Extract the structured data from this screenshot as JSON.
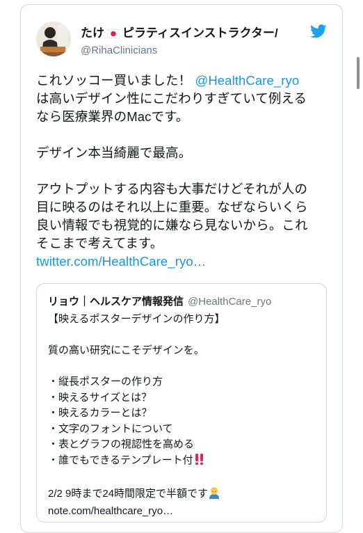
{
  "tweet": {
    "display_name": "たけ",
    "display_name_suffix": "ピラティスインストラクター/",
    "handle": "@RihaClinicians",
    "line1_prefix": "これソッコー買いました！",
    "mention": "@HealthCare_ryo",
    "line2": "は高いデザイン性にこだわりすぎていて例える",
    "line3": "なら医療業界のMacです。",
    "para2": "デザイン本当綺麗で最高。",
    "para3_line1": "アウトプットする内容も大事だけどそれが人の",
    "para3_line2": "目に映るのはそれ以上に重要。なぜならいくら",
    "para3_line3": "良い情報でも視覚的に嫌なら見ないから。これ",
    "para3_line4": "そこまで考えてます。",
    "link": "twitter.com/HealthCare_ryo…"
  },
  "quote": {
    "name": "リョウ｜ヘルスケア情報発信",
    "handle": "@HealthCare_ryo",
    "title": "【映えるポスターデザインの作り方】",
    "intro": "質の高い研究にこそデザインを。",
    "items": [
      "・縦長ポスターの作り方",
      "・映えるサイズとは？",
      "・映えるカラーとは？",
      "・文字のフォントについて",
      "・表とグラフの視認性を高める",
      "・誰でもできるテンプレート付"
    ],
    "footer": "2/2  9時まで24時間限定で半額です",
    "link": "note.com/healthcare_ryo…"
  },
  "icons": {
    "flag": "japan-flag-icon",
    "bird": "twitter-bird-icon",
    "exclamation": "double-exclamation-icon",
    "person": "person-emoji-icon"
  },
  "colors": {
    "link": "#1b95e0",
    "secondary": "#657786",
    "border": "#cfd9de",
    "twitter_blue": "#1da1f2",
    "exclamation_red": "#e0245e"
  }
}
